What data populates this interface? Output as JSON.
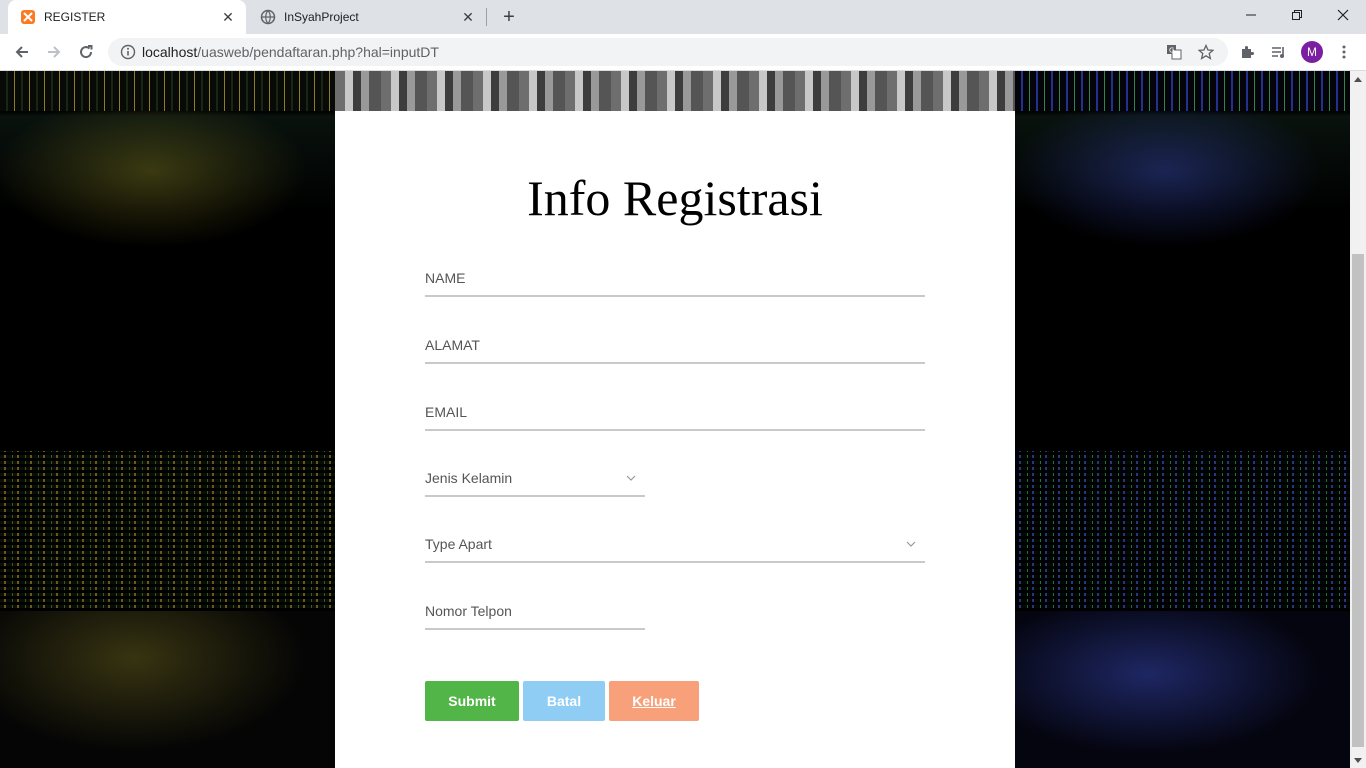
{
  "browser": {
    "tabs": [
      {
        "title": "REGISTER",
        "active": true,
        "favicon": "xampp-icon"
      },
      {
        "title": "InSyahProject",
        "active": false,
        "favicon": "globe-icon"
      }
    ],
    "url_host": "localhost",
    "url_path": "/uasweb/pendaftaran.php?hal=inputDT",
    "profile_initial": "M",
    "profile_color": "#7b1fa2"
  },
  "form": {
    "title": "Info Registrasi",
    "fields": {
      "name_placeholder": "NAME",
      "alamat_placeholder": "ALAMAT",
      "email_placeholder": "EMAIL",
      "gender_select": "Jenis Kelamin",
      "type_select": "Type Apart",
      "phone_placeholder": "Nomor Telpon"
    },
    "buttons": {
      "submit": "Submit",
      "batal": "Batal",
      "keluar": "Keluar"
    },
    "colors": {
      "submit": "#52b548",
      "batal": "#90cdf4",
      "keluar": "#f8a07a"
    }
  }
}
